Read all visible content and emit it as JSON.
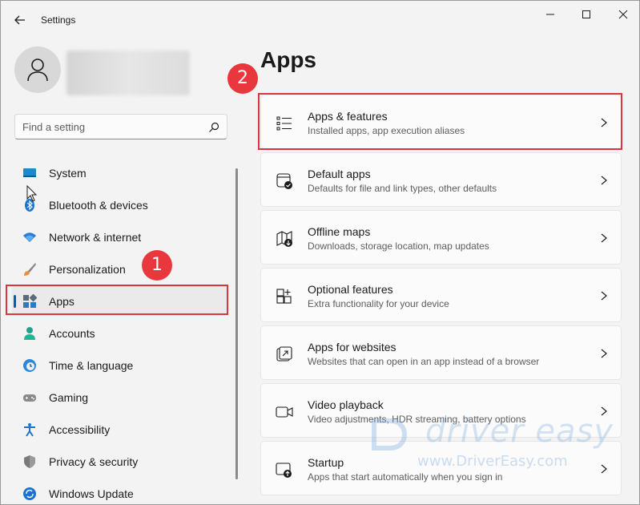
{
  "window": {
    "title": "Settings",
    "controls": {
      "minimize": "minimize-icon",
      "maximize": "maximize-icon",
      "close": "close-icon"
    }
  },
  "search": {
    "placeholder": "Find a setting",
    "value": ""
  },
  "sidebar": {
    "items": [
      {
        "label": "System",
        "icon": "monitor-icon"
      },
      {
        "label": "Bluetooth & devices",
        "icon": "bluetooth-icon"
      },
      {
        "label": "Network & internet",
        "icon": "wifi-icon"
      },
      {
        "label": "Personalization",
        "icon": "brush-icon"
      },
      {
        "label": "Apps",
        "icon": "apps-icon",
        "selected": true
      },
      {
        "label": "Accounts",
        "icon": "person-icon"
      },
      {
        "label": "Time & language",
        "icon": "clock-globe-icon"
      },
      {
        "label": "Gaming",
        "icon": "gamepad-icon"
      },
      {
        "label": "Accessibility",
        "icon": "accessibility-icon"
      },
      {
        "label": "Privacy & security",
        "icon": "shield-icon"
      },
      {
        "label": "Windows Update",
        "icon": "update-icon"
      }
    ]
  },
  "main": {
    "title": "Apps",
    "cards": [
      {
        "title": "Apps & features",
        "desc": "Installed apps, app execution aliases",
        "icon": "list-icon"
      },
      {
        "title": "Default apps",
        "desc": "Defaults for file and link types, other defaults",
        "icon": "default-apps-icon"
      },
      {
        "title": "Offline maps",
        "desc": "Downloads, storage location, map updates",
        "icon": "map-icon"
      },
      {
        "title": "Optional features",
        "desc": "Extra functionality for your device",
        "icon": "add-grid-icon"
      },
      {
        "title": "Apps for websites",
        "desc": "Websites that can open in an app instead of a browser",
        "icon": "open-link-icon"
      },
      {
        "title": "Video playback",
        "desc": "Video adjustments, HDR streaming, battery options",
        "icon": "video-icon"
      },
      {
        "title": "Startup",
        "desc": "Apps that start automatically when you sign in",
        "icon": "startup-icon"
      }
    ]
  },
  "annotations": {
    "step1": "1",
    "step2": "2"
  },
  "watermark": {
    "brand": "driver easy",
    "url": "www.DriverEasy.com"
  },
  "colors": {
    "accent": "#005fb8",
    "highlight": "#d9363e",
    "badge": "#e8383d"
  }
}
